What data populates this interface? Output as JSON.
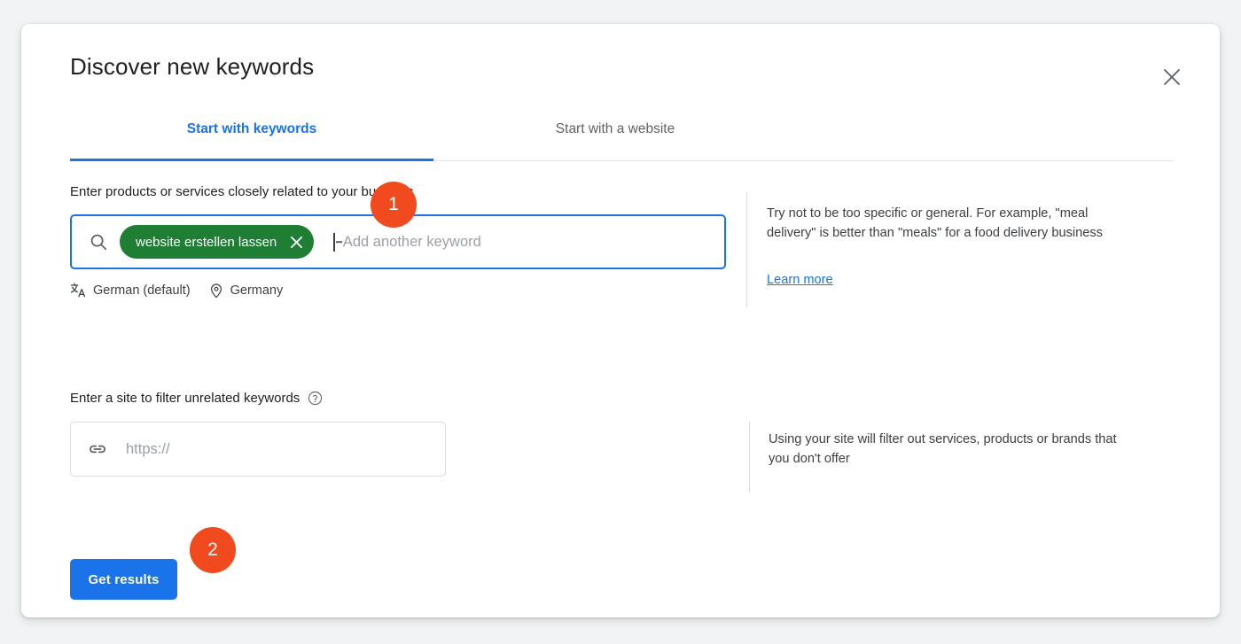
{
  "dialog": {
    "title": "Discover new keywords",
    "close_icon": "close-icon"
  },
  "tabs": [
    {
      "label": "Start with keywords",
      "active": true
    },
    {
      "label": "Start with a website",
      "active": false
    }
  ],
  "keywords_section": {
    "label": "Enter products or services closely related to your business",
    "search_icon": "search-icon",
    "chips": [
      {
        "text": "website erstellen lassen",
        "remove_icon": "close-icon",
        "color": "#1e7e34"
      }
    ],
    "placeholder": "Add another keyword",
    "meta": [
      {
        "icon": "translate-icon",
        "label": "German (default)"
      },
      {
        "icon": "location-pin-icon",
        "label": "Germany"
      }
    ],
    "help_text": "Try not to be too specific or general. For example, \"meal delivery\" is better than \"meals\" for a food delivery business",
    "learn_more": "Learn more"
  },
  "site_section": {
    "label": "Enter a site to filter unrelated keywords",
    "help_icon": "help-circle-icon",
    "link_icon": "link-icon",
    "placeholder": "https://",
    "value": "",
    "help_text": "Using your site will filter out services, products or brands that you don't offer"
  },
  "footer": {
    "submit_label": "Get results"
  },
  "annotations": [
    {
      "number": "1",
      "color": "#f04a1e"
    },
    {
      "number": "2",
      "color": "#f04a1e"
    }
  ],
  "colors": {
    "accent_blue": "#1a73e8",
    "chip_green": "#1e7e34",
    "marker_orange": "#f04a1e",
    "page_background": "#f1f3f4"
  }
}
